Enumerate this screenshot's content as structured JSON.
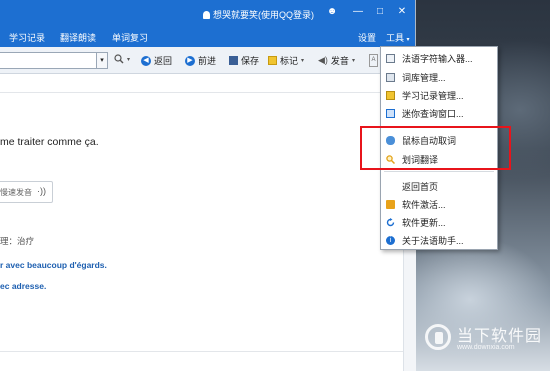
{
  "titlebar": {
    "user_label": "想哭就要笑(使用QQ登录)",
    "controls": [
      "☻",
      "—",
      "□",
      "✕"
    ]
  },
  "menubar": {
    "items": [
      "学习记录",
      "翻译朗读",
      "单词复习"
    ],
    "settings": "设置",
    "tools": "工具"
  },
  "toolbar": {
    "back": "返回",
    "forward": "前进",
    "save": "保存",
    "mark": "标记",
    "speak": "发音"
  },
  "content": {
    "sentence": "me traiter comme ça.",
    "speak_button": "慢速发音",
    "medical": "理：治疗",
    "example1": "r avec beaucoup d'égards.",
    "example2": "ec adresse."
  },
  "dropdown": {
    "items": [
      {
        "label": "法语字符输入器...",
        "icon": "keyboard-icon"
      },
      {
        "label": "词库管理...",
        "icon": "library-icon"
      },
      {
        "label": "学习记录管理...",
        "icon": "notebook-icon"
      },
      {
        "label": "迷你查询窗口...",
        "icon": "mini-window-icon"
      },
      {
        "label": "鼠标自动取词",
        "icon": "mouse-icon"
      },
      {
        "label": "划词翻译",
        "icon": "magnifier-icon"
      },
      {
        "label": "返回首页",
        "icon": ""
      },
      {
        "label": "软件激活...",
        "icon": "lock-icon"
      },
      {
        "label": "软件更新...",
        "icon": "refresh-icon"
      },
      {
        "label": "关于法语助手...",
        "icon": "info-icon"
      }
    ]
  },
  "watermark": {
    "title": "当下软件园",
    "url": "www.downxia.com"
  },
  "colors": {
    "accent": "#1d6fd1",
    "highlight": "#e8141b",
    "example_text": "#1d5fb0"
  }
}
